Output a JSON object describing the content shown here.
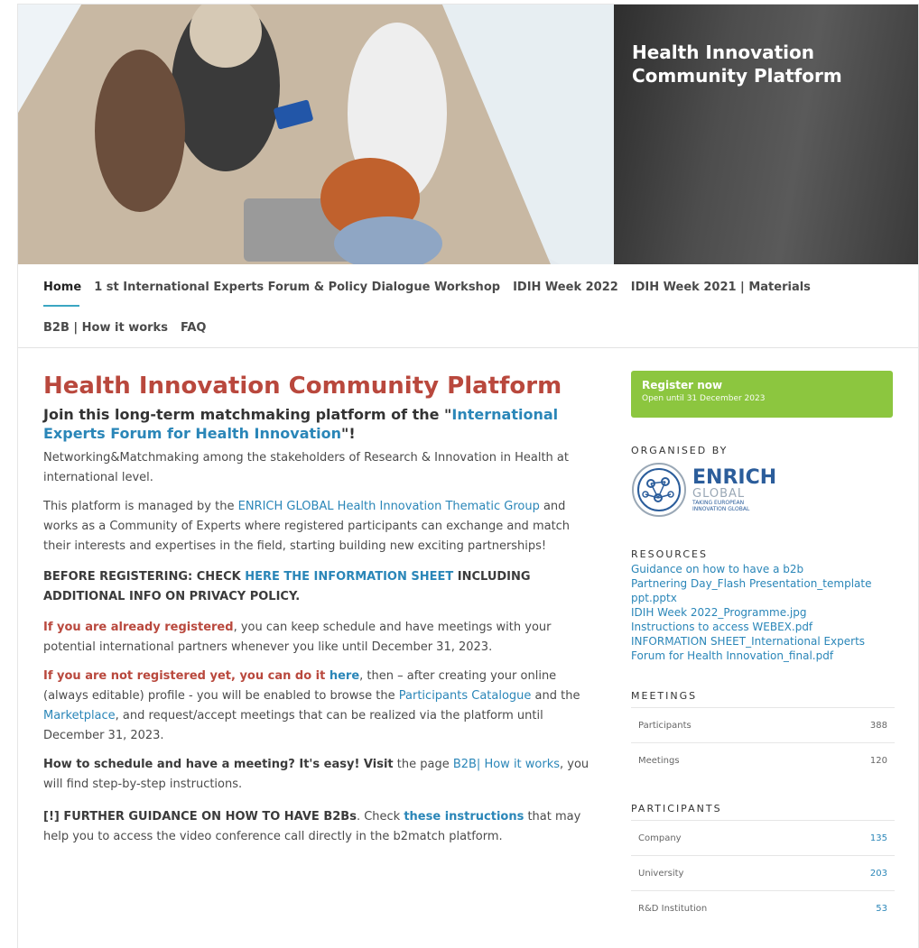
{
  "hero": {
    "title": "Health Innovation Community Platform"
  },
  "nav": {
    "row1": [
      "Home",
      "1 st International Experts Forum & Policy Dialogue Workshop",
      "IDIH Week 2022",
      "IDIH Week 2021 | Materials"
    ],
    "row2": [
      "B2B | How it works",
      "FAQ"
    ]
  },
  "main": {
    "title": "Health Innovation Community Platform",
    "subtitle_a": "Join this long-term matchmaking platform of the \"",
    "subtitle_link": "International Experts Forum for Health Innovation",
    "subtitle_b": "\"!",
    "p1": "Networking&Matchmaking among the stakeholders of Research & Innovation in Health at international level.",
    "p2_a": "This platform is managed by the ",
    "p2_link": "ENRICH GLOBAL Health Innovation Thematic Group",
    "p2_b": " and works as a Community of Experts where registered participants can exchange and match their interests and expertises in the field, starting building new exciting partnerships!",
    "p3_a": "BEFORE REGISTERING: CHECK ",
    "p3_link": "HERE THE INFORMATION SHEET",
    "p3_b": " INCLUDING ADDITIONAL INFO ON PRIVACY POLICY.",
    "p4_red": "If you are already registered",
    "p4_b": ", you can keep schedule and have meetings with your potential international partners whenever you like until December 31, 2023.",
    "p5_red": "If you are not registered yet, you can do it ",
    "p5_here": "here",
    "p5_b": ", then – after creating your online (always editable) profile - you will be enabled to browse the ",
    "p5_link1": "Participants Catalogue",
    "p5_c": " and the ",
    "p5_link2": "Marketplace",
    "p5_d": ", and request/accept meetings that can be realized via the platform until December 31, 2023.",
    "p6_bold": "How to schedule and have a meeting? It's easy! Visit",
    "p6_a": " the page ",
    "p6_link": "B2B| How it works",
    "p6_b": ", you will find step-by-step instructions.",
    "p7_bold": "[!] FURTHER GUIDANCE ON HOW TO HAVE B2Bs",
    "p7_a": ". Check ",
    "p7_link": "these instructions",
    "p7_b": " that may help you to access the video conference call directly in the b2match platform."
  },
  "sidebar": {
    "register_title": "Register now",
    "register_sub": "Open until 31 December 2023",
    "organised_title": "ORGANISED BY",
    "logo_big": "ENRICH",
    "logo_global": "GLOBAL",
    "logo_tag1": "TAKING EUROPEAN",
    "logo_tag2": "INNOVATION GLOBAL",
    "resources_title": "RESOURCES",
    "resources": [
      "Guidance on how to have a b2b",
      "Partnering Day_Flash Presentation_template ppt.pptx",
      "IDIH Week 2022_Programme.jpg",
      "Instructions to access WEBEX.pdf",
      "INFORMATION SHEET_International Experts Forum for Health Innovation_final.pdf"
    ],
    "meetings_title": "MEETINGS",
    "meetings": [
      {
        "label": "Participants",
        "value": "388"
      },
      {
        "label": "Meetings",
        "value": "120"
      }
    ],
    "participants_title": "PARTICIPANTS",
    "participants": [
      {
        "label": "Company",
        "value": "135"
      },
      {
        "label": "University",
        "value": "203"
      },
      {
        "label": "R&D Institution",
        "value": "53"
      }
    ]
  },
  "colors": {
    "title_red": "#b9483d",
    "link_blue": "#2a86b8",
    "register_green": "#8cc63f",
    "nav_accent": "#3aa6c2"
  }
}
